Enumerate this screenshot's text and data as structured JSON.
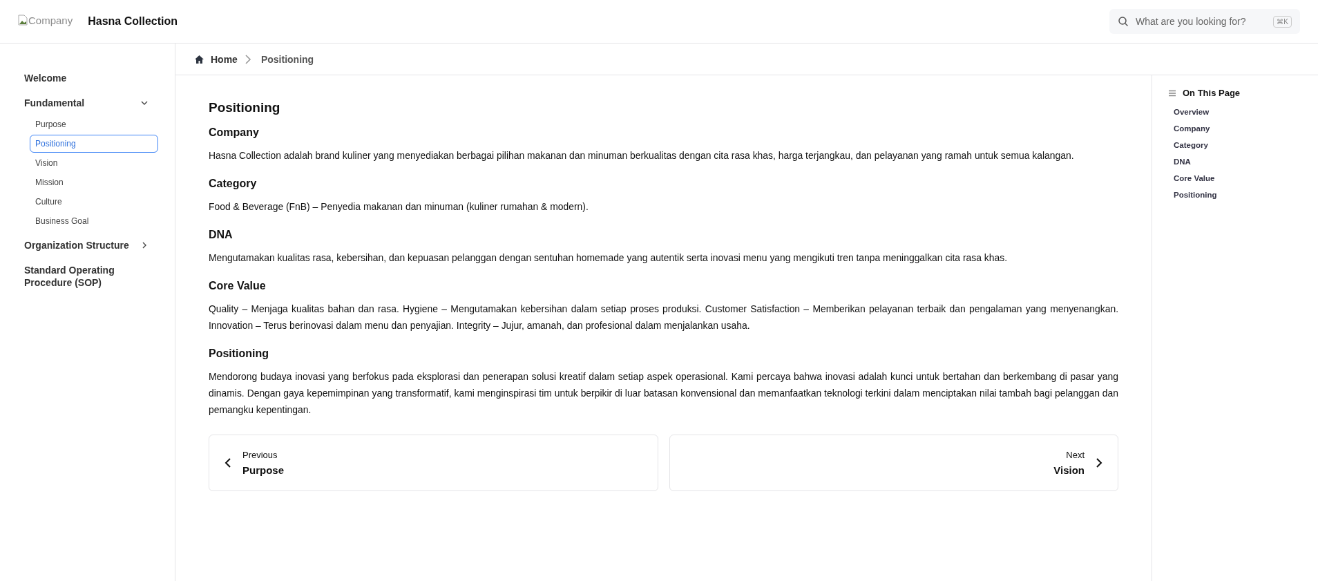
{
  "header": {
    "logo_alt": "Company",
    "title": "Hasna Collection",
    "search": {
      "placeholder": "What are you looking for?",
      "shortcut": "⌘K"
    }
  },
  "sidebar": {
    "items": [
      {
        "label": "Welcome",
        "kind": "link"
      },
      {
        "label": "Fundamental",
        "kind": "group",
        "expanded": true,
        "children": [
          {
            "label": "Purpose",
            "selected": false
          },
          {
            "label": "Positioning",
            "selected": true
          },
          {
            "label": "Vision",
            "selected": false
          },
          {
            "label": "Mission",
            "selected": false
          },
          {
            "label": "Culture",
            "selected": false
          },
          {
            "label": "Business Goal",
            "selected": false
          }
        ]
      },
      {
        "label": "Organization Structure",
        "kind": "group",
        "expanded": false
      },
      {
        "label": "Standard Operating Procedure (SOP)",
        "kind": "link"
      }
    ]
  },
  "breadcrumb": [
    "Home",
    "Positioning"
  ],
  "page": {
    "title": "Positioning",
    "sections": [
      {
        "heading": "Company",
        "text": "Hasna Collection adalah brand kuliner yang menyediakan berbagai pilihan makanan dan minuman berkualitas dengan cita rasa khas, harga terjangkau, dan pelayanan yang ramah untuk semua kalangan."
      },
      {
        "heading": "Category",
        "text": "Food & Beverage (FnB) – Penyedia makanan dan minuman (kuliner rumahan & modern)."
      },
      {
        "heading": "DNA",
        "text": "Mengutamakan kualitas rasa, kebersihan, dan kepuasan pelanggan dengan sentuhan homemade yang autentik serta inovasi menu yang mengikuti tren tanpa meninggalkan cita rasa khas."
      },
      {
        "heading": "Core Value",
        "text": "Quality – Menjaga kualitas bahan dan rasa. Hygiene – Mengutamakan kebersihan dalam setiap proses produksi. Customer Satisfaction – Memberikan pelayanan terbaik dan pengalaman yang menyenangkan. Innovation – Terus berinovasi dalam menu dan penyajian. Integrity – Jujur, amanah, dan profesional dalam menjalankan usaha."
      },
      {
        "heading": "Positioning",
        "text": "Mendorong budaya inovasi yang berfokus pada eksplorasi dan penerapan solusi kreatif dalam setiap aspek operasional. Kami percaya bahwa inovasi adalah kunci untuk bertahan dan berkembang di pasar yang dinamis. Dengan gaya kepemimpinan yang transformatif, kami menginspirasi tim untuk berpikir di luar batasan konvensional dan memanfaatkan teknologi terkini dalam menciptakan nilai tambah bagi pelanggan dan pemangku kepentingan."
      }
    ],
    "prev": {
      "caption": "Previous",
      "title": "Purpose"
    },
    "next": {
      "caption": "Next",
      "title": "Vision"
    }
  },
  "toc": {
    "title": "On This Page",
    "items": [
      "Overview",
      "Company",
      "Category",
      "DNA",
      "Core Value",
      "Positioning"
    ]
  }
}
